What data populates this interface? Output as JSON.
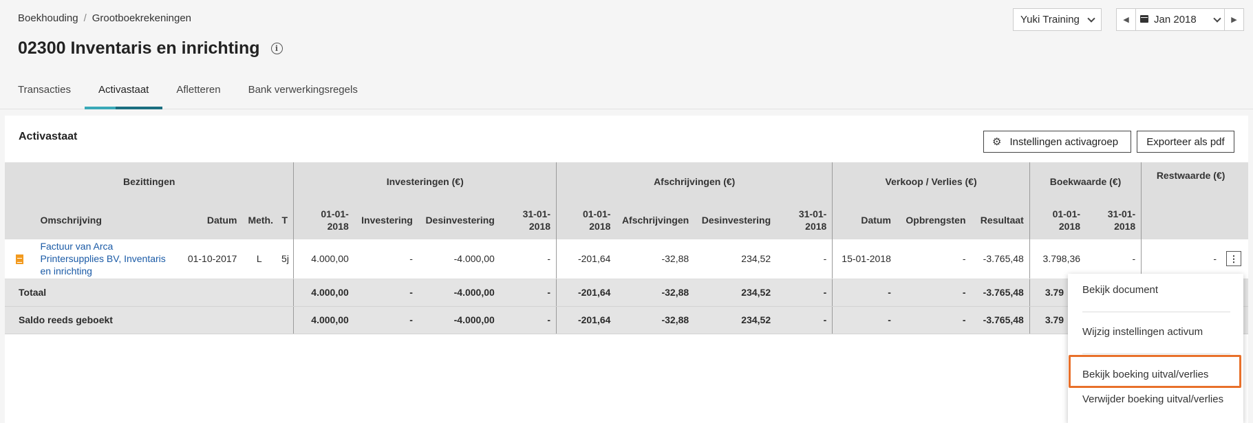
{
  "breadcrumb": {
    "root": "Boekhouding",
    "separator": "/",
    "current": "Grootboekrekeningen"
  },
  "page": {
    "title": "02300 Inventaris en inrichting"
  },
  "header": {
    "company": "Yuki Training",
    "period": "Jan 2018"
  },
  "tabs": [
    {
      "label": "Transacties"
    },
    {
      "label": "Activastaat"
    },
    {
      "label": "Afletteren"
    },
    {
      "label": "Bank verwerkingsregels"
    }
  ],
  "card": {
    "title": "Activastaat",
    "settings_button": "Instellingen activagroep",
    "export_button": "Exporteer als pdf"
  },
  "table": {
    "groups": {
      "bezittingen": "Bezittingen",
      "investeringen": "Investeringen (€)",
      "afschrijvingen": "Afschrijvingen (€)",
      "verkoop": "Verkoop / Verlies (€)",
      "boekwaarde": "Boekwaarde (€)",
      "restwaarde": "Restwaarde (€)"
    },
    "columns": {
      "omschrijving": "Omschrijving",
      "datum": "Datum",
      "meth": "Meth.",
      "t": "T",
      "inv_start": "01-01-2018",
      "investering": "Investering",
      "inv_desinvestering": "Desinvestering",
      "inv_end": "31-01-2018",
      "afs_start": "01-01-2018",
      "afschrijvingen": "Afschrijvingen",
      "afs_desinvestering": "Desinvestering",
      "afs_end": "31-01-2018",
      "verkoop_datum": "Datum",
      "opbrengsten": "Opbrengsten",
      "resultaat": "Resultaat",
      "bw_start": "01-01-2018",
      "bw_end": "31-01-2018"
    },
    "row": {
      "omschrijving": "Factuur van Arca Printersupplies BV, Inventaris en inrichting",
      "datum": "01-10-2017",
      "meth": "L",
      "t": "5j",
      "inv_start": "4.000,00",
      "investering": "-",
      "inv_desinvestering": "-4.000,00",
      "inv_end": "-",
      "afs_start": "-201,64",
      "afschrijvingen": "-32,88",
      "afs_desinvestering": "234,52",
      "afs_end": "-",
      "verkoop_datum": "15-01-2018",
      "opbrengsten": "-",
      "resultaat": "-3.765,48",
      "bw_start": "3.798,36",
      "bw_end": "-",
      "restwaarde": "-"
    },
    "totaal": {
      "label": "Totaal",
      "inv_start": "4.000,00",
      "investering": "-",
      "inv_desinvestering": "-4.000,00",
      "inv_end": "-",
      "afs_start": "-201,64",
      "afschrijvingen": "-32,88",
      "afs_desinvestering": "234,52",
      "afs_end": "-",
      "verkoop_datum": "-",
      "opbrengsten": "-",
      "resultaat": "-3.765,48",
      "bw_start": "3.79"
    },
    "saldo": {
      "label": "Saldo reeds geboekt",
      "inv_start": "4.000,00",
      "investering": "-",
      "inv_desinvestering": "-4.000,00",
      "inv_end": "-",
      "afs_start": "-201,64",
      "afschrijvingen": "-32,88",
      "afs_desinvestering": "234,52",
      "afs_end": "-",
      "verkoop_datum": "-",
      "opbrengsten": "-",
      "resultaat": "-3.765,48",
      "bw_start": "3.79"
    }
  },
  "context_menu": {
    "items": [
      "Bekijk document",
      "Wijzig instellingen activum",
      "Bekijk boeking uitval/verlies",
      "Verwijder boeking uitval/verlies"
    ]
  },
  "colors": {
    "accent": "#1b6e80",
    "accent_light": "#3aa9b8",
    "highlight": "#e8702a",
    "link": "#1a5aa6",
    "doc_icon": "#f29a1f"
  }
}
